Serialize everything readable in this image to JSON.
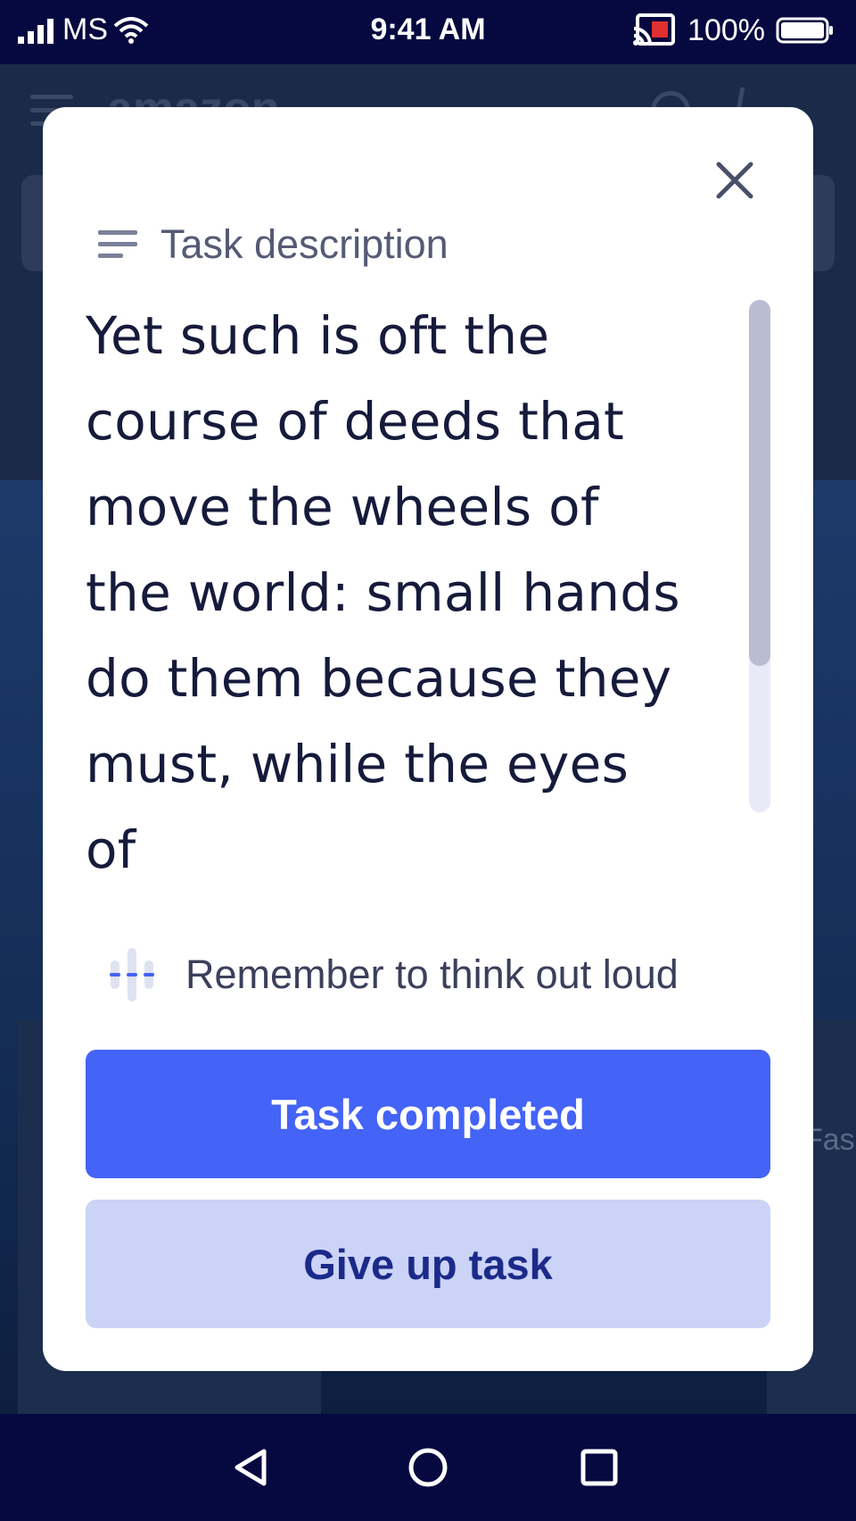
{
  "status_bar": {
    "carrier": "MS",
    "time": "9:41 AM",
    "battery": "100%"
  },
  "background": {
    "logo": "amazon",
    "fashion_label": "Fasl"
  },
  "modal": {
    "task_label": "Task description",
    "task_text": "Yet such is oft the course of deeds that move the wheels of the world: small hands do them because they must, while the eyes of",
    "reminder": "Remember to think out loud",
    "primary_button": "Task completed",
    "secondary_button": "Give up task"
  },
  "colors": {
    "primary": "#4463f7",
    "secondary": "#cbd3f6",
    "system_bar": "#06093f"
  },
  "icons": [
    "signal-icon",
    "wifi-icon",
    "cast-icon",
    "battery-icon",
    "close-icon",
    "description-icon",
    "audio-wave-icon",
    "back-icon",
    "home-icon",
    "recents-icon"
  ]
}
